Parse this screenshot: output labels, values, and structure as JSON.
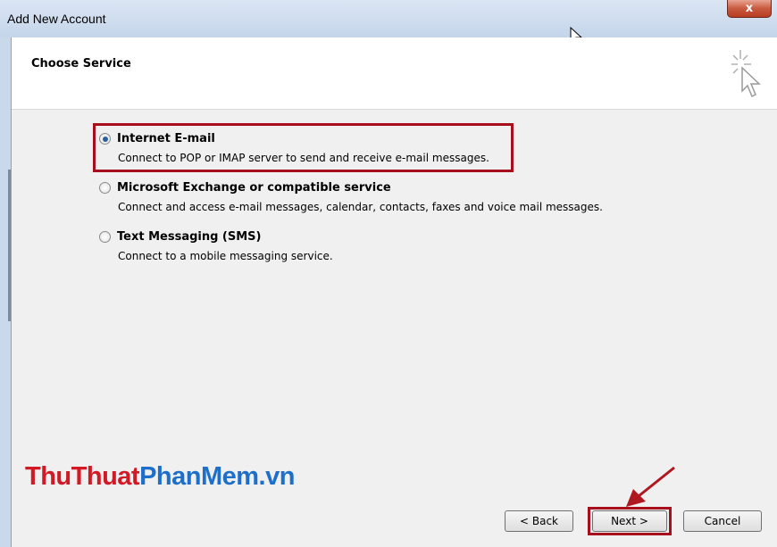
{
  "window": {
    "title": "Add New Account",
    "close_label": "x"
  },
  "header": {
    "title": "Choose Service"
  },
  "options": [
    {
      "label": "Internet E-mail",
      "description": "Connect to POP or IMAP server to send and receive e-mail messages.",
      "selected": true
    },
    {
      "label": "Microsoft Exchange or compatible service",
      "description": "Connect and access e-mail messages, calendar, contacts, faxes and voice mail messages.",
      "selected": false
    },
    {
      "label": "Text Messaging (SMS)",
      "description": "Connect to a mobile messaging service.",
      "selected": false
    }
  ],
  "watermark": {
    "part1": "ThuThuat",
    "part2": "PhanMem.vn"
  },
  "buttons": {
    "back": "< Back",
    "next": "Next >",
    "cancel": "Cancel"
  },
  "colors": {
    "highlight": "#a80f1d",
    "radio_selected": "#2a5f9e",
    "watermark_red": "#d11a26",
    "watermark_blue": "#1d6fc9"
  }
}
